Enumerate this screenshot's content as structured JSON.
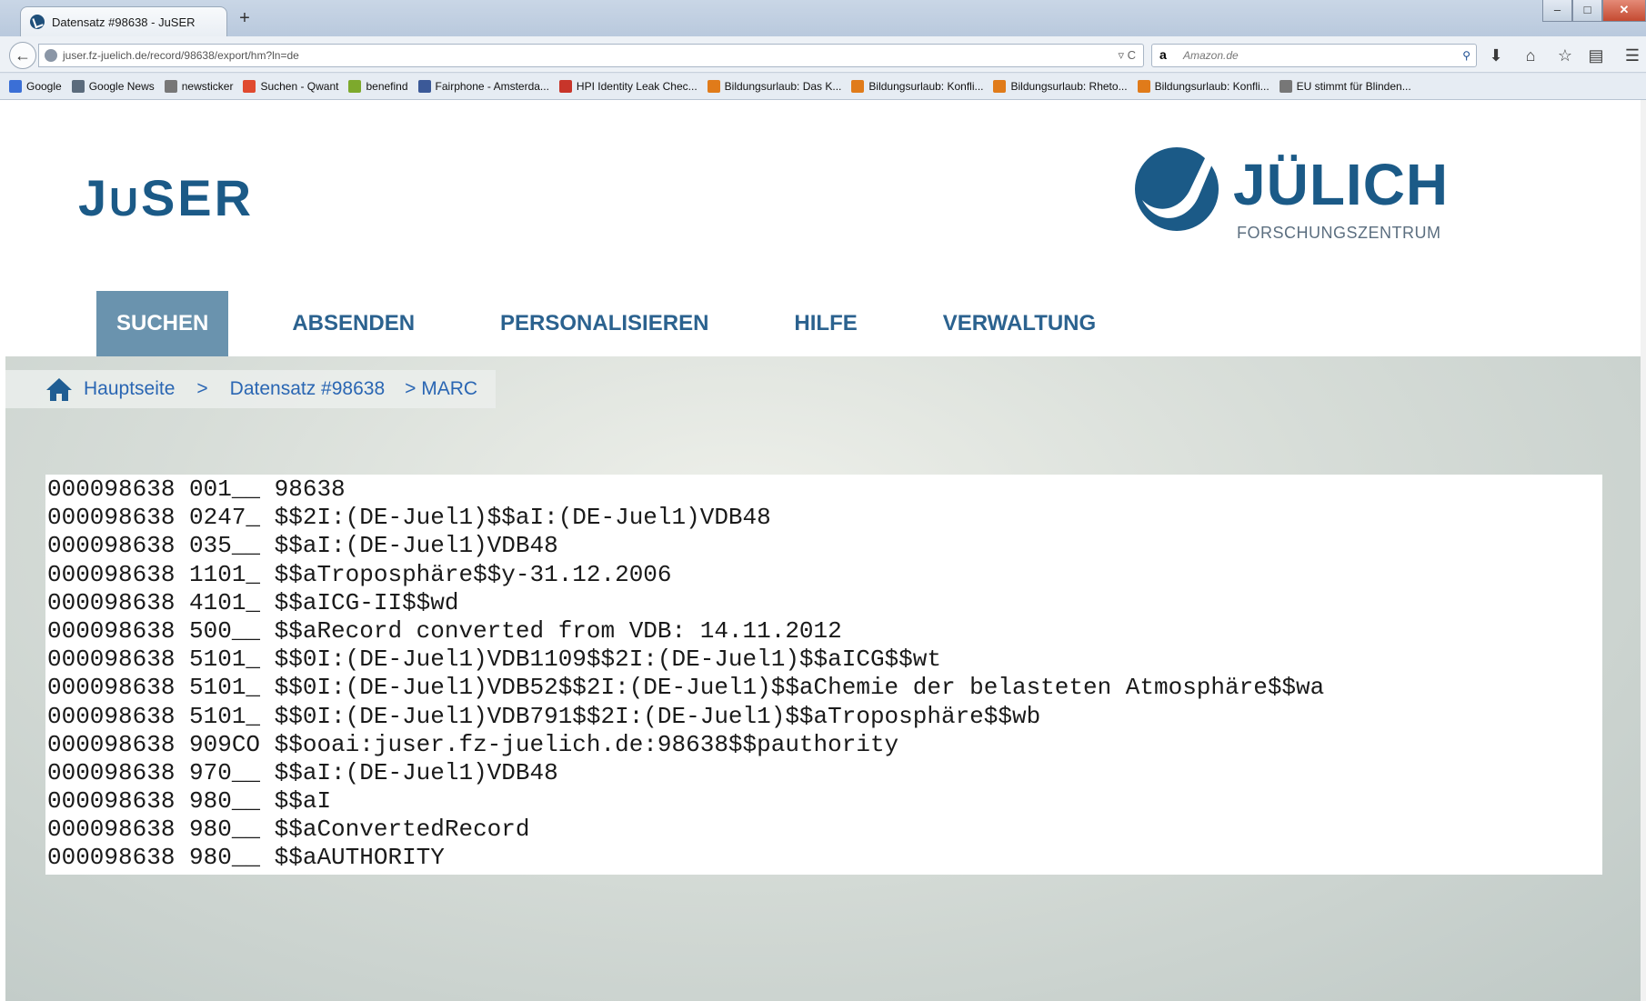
{
  "browser": {
    "tab_title": "Datensatz #98638 - JuSER",
    "new_tab": "+",
    "url": "juser.fz-juelich.de/record/98638/export/hm?ln=de",
    "search_placeholder": "Amazon.de",
    "window_controls": [
      "minimize",
      "maximize",
      "close"
    ],
    "bookmarks": [
      {
        "label": "Google",
        "icon": "google-icon",
        "color": "#3b6fd6"
      },
      {
        "label": "Google News",
        "icon": "news-icon",
        "color": "#5b6b7c"
      },
      {
        "label": "newsticker",
        "icon": "newsticker-icon",
        "color": "#777777"
      },
      {
        "label": "Suchen - Qwant",
        "icon": "qwant-icon",
        "color": "#e04a2f"
      },
      {
        "label": "benefind",
        "icon": "benefind-icon",
        "color": "#7da92c"
      },
      {
        "label": "Fairphone - Amsterda...",
        "icon": "facebook-icon",
        "color": "#3b5998"
      },
      {
        "label": "HPI Identity Leak Chec...",
        "icon": "hpi-icon",
        "color": "#c8352a"
      },
      {
        "label": "Bildungsurlaub: Das K...",
        "icon": "link-icon",
        "color": "#e07b1a"
      },
      {
        "label": "Bildungsurlaub: Konfli...",
        "icon": "link-icon",
        "color": "#e07b1a"
      },
      {
        "label": "Bildungsurlaub: Rheto...",
        "icon": "link-icon",
        "color": "#e07b1a"
      },
      {
        "label": "Bildungsurlaub: Konfli...",
        "icon": "link-icon",
        "color": "#e07b1a"
      },
      {
        "label": "EU stimmt für Blinden...",
        "icon": "newsticker-icon",
        "color": "#777777"
      }
    ]
  },
  "site": {
    "logo_j": "J",
    "logo_u": "U",
    "logo_ser": "SER",
    "partner_name": "JÜLICH",
    "partner_sub": "FORSCHUNGSZENTRUM",
    "brand_color": "#1b5a87"
  },
  "menu": [
    {
      "label": "SUCHEN",
      "active": true
    },
    {
      "label": "ABSENDEN",
      "active": false
    },
    {
      "label": "PERSONALISIEREN",
      "active": false
    },
    {
      "label": "HILFE",
      "active": false
    },
    {
      "label": "VERWALTUNG",
      "active": false
    }
  ],
  "breadcrumb": {
    "home": "Hauptseite",
    "sep1": ">",
    "record": "Datensatz #98638",
    "current": "> MARC"
  },
  "marc_records": [
    "000098638 001__ 98638",
    "000098638 0247_ $$2I:(DE-Juel1)$$aI:(DE-Juel1)VDB48",
    "000098638 035__ $$aI:(DE-Juel1)VDB48",
    "000098638 1101_ $$aTroposphäre$$y-31.12.2006",
    "000098638 4101_ $$aICG-II$$wd",
    "000098638 500__ $$aRecord converted from VDB: 14.11.2012",
    "000098638 5101_ $$0I:(DE-Juel1)VDB1109$$2I:(DE-Juel1)$$aICG$$wt",
    "000098638 5101_ $$0I:(DE-Juel1)VDB52$$2I:(DE-Juel1)$$aChemie der belasteten Atmosphäre$$wa",
    "000098638 5101_ $$0I:(DE-Juel1)VDB791$$2I:(DE-Juel1)$$aTroposphäre$$wb",
    "000098638 909CO $$ooai:juser.fz-juelich.de:98638$$pauthority",
    "000098638 970__ $$aI:(DE-Juel1)VDB48",
    "000098638 980__ $$aI",
    "000098638 980__ $$aConvertedRecord",
    "000098638 980__ $$aAUTHORITY"
  ]
}
